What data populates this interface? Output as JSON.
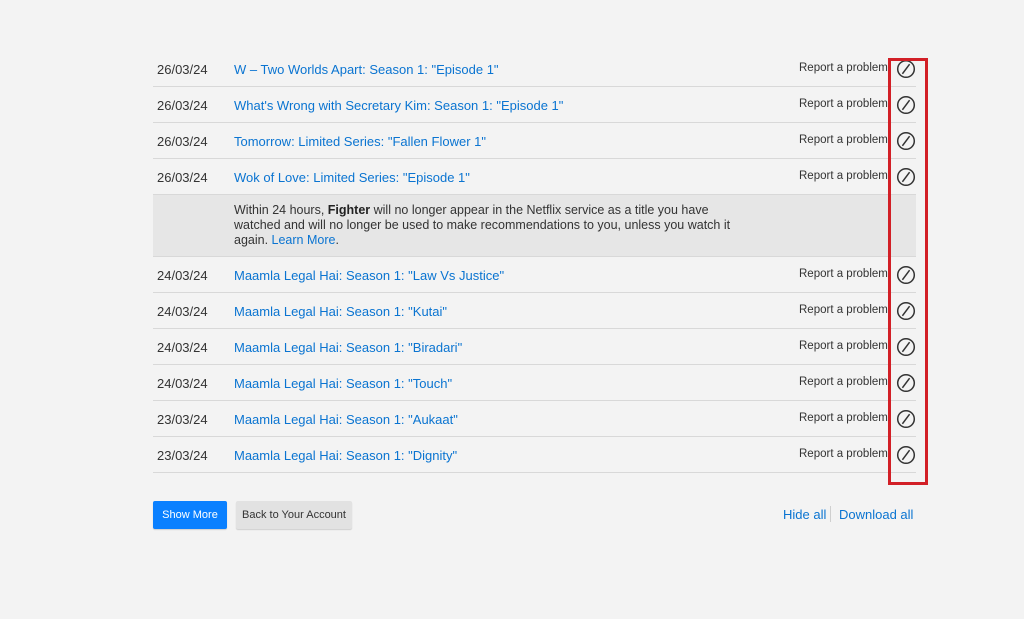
{
  "activity": {
    "rows_before_notice": [
      {
        "date": "26/03/24",
        "title": "W – Two Worlds Apart: Season 1: \"Episode 1\"",
        "report": "Report a problem",
        "icon": "hide-from-history-icon"
      },
      {
        "date": "26/03/24",
        "title": "What's Wrong with Secretary Kim: Season 1: \"Episode 1\"",
        "report": "Report a problem",
        "icon": "hide-from-history-icon"
      },
      {
        "date": "26/03/24",
        "title": "Tomorrow: Limited Series: \"Fallen Flower 1\"",
        "report": "Report a problem",
        "icon": "hide-from-history-icon"
      },
      {
        "date": "26/03/24",
        "title": "Wok of Love: Limited Series: \"Episode 1\"",
        "report": "Report a problem",
        "icon": "hide-from-history-icon"
      }
    ],
    "notice": {
      "prefix": "Within 24 hours, ",
      "title": "Fighter",
      "body": " will no longer appear in the Netflix service as a title you have watched and will no longer be used to make recommendations to you, unless you watch it again. ",
      "link": "Learn More",
      "suffix": "."
    },
    "rows_after_notice": [
      {
        "date": "24/03/24",
        "title": "Maamla Legal Hai: Season 1: \"Law Vs Justice\"",
        "report": "Report a problem",
        "icon": "hide-from-history-icon"
      },
      {
        "date": "24/03/24",
        "title": "Maamla Legal Hai: Season 1: \"Kutai\"",
        "report": "Report a problem",
        "icon": "hide-from-history-icon"
      },
      {
        "date": "24/03/24",
        "title": "Maamla Legal Hai: Season 1: \"Biradari\"",
        "report": "Report a problem",
        "icon": "hide-from-history-icon"
      },
      {
        "date": "24/03/24",
        "title": "Maamla Legal Hai: Season 1: \"Touch\"",
        "report": "Report a problem",
        "icon": "hide-from-history-icon"
      },
      {
        "date": "23/03/24",
        "title": "Maamla Legal Hai: Season 1: \"Aukaat\"",
        "report": "Report a problem",
        "icon": "hide-from-history-icon"
      },
      {
        "date": "23/03/24",
        "title": "Maamla Legal Hai: Season 1: \"Dignity\"",
        "report": "Report a problem",
        "icon": "hide-from-history-icon"
      }
    ]
  },
  "footer": {
    "show_more": "Show More",
    "back_to_account": "Back to Your Account",
    "hide_all": "Hide all",
    "download_all": "Download all"
  },
  "colors": {
    "link": "#0a74d1",
    "primary_button": "#0a80ff",
    "highlight": "#d21f26",
    "background": "#f3f3f3"
  }
}
